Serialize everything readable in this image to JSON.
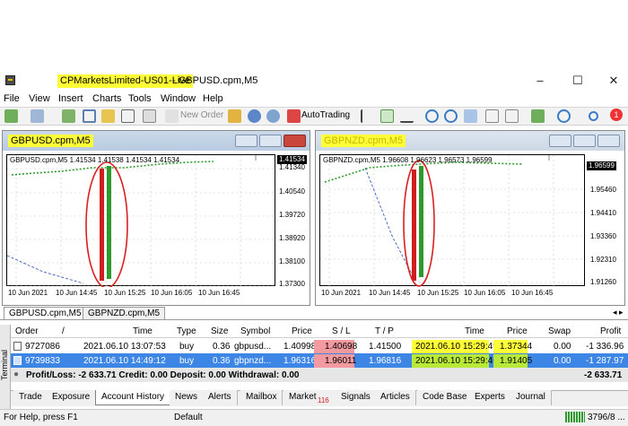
{
  "window": {
    "title_highlight": "CPMarketsLimited-US01-Live",
    "title_rest": "- GBPUSD.cpm,M5",
    "controls": [
      "–",
      "☐",
      "✕"
    ]
  },
  "menu": [
    "File",
    "View",
    "Insert",
    "Charts",
    "Tools",
    "Window",
    "Help"
  ],
  "toolbar": {
    "new_order": "New Order",
    "autotrading": "AutoTrading",
    "notification_count": "1"
  },
  "charts": [
    {
      "title": "GBPUSD.cpm,M5",
      "info": "GBPUSD.cpm,M5  1.41534 1.41538 1.41534 1.41534",
      "current_price": "1.41534",
      "yticks": [
        "1.41340",
        "1.40540",
        "1.39720",
        "1.38920",
        "1.38100",
        "1.37300"
      ],
      "xticks": [
        "10 Jun 2021",
        "10 Jun 14:45",
        "10 Jun 15:25",
        "10 Jun 16:05",
        "10 Jun 16:45"
      ]
    },
    {
      "title": "GBPNZD.cpm,M5",
      "info": "GBPNZD.cpm,M5  1.96608 1.96623 1.96573 1.96599",
      "current_price": "1.96599",
      "yticks": [
        "1.95460",
        "1.94410",
        "1.93360",
        "1.92310",
        "1.91260"
      ],
      "xticks": [
        "10 Jun 2021",
        "10 Jun 14:45",
        "10 Jun 15:25",
        "10 Jun 16:05",
        "10 Jun 16:45"
      ]
    }
  ],
  "chart_tabs": [
    "GBPUSD.cpm,M5",
    "GBPNZD.cpm,M5"
  ],
  "terminal": {
    "headers": [
      "Order",
      "/",
      "Time",
      "Type",
      "Size",
      "Symbol",
      "Price",
      "S / L",
      "T / P",
      "Time",
      "Price",
      "Swap",
      "Profit"
    ],
    "rows": [
      {
        "order": "9727086",
        "time": "2021.06.10 13:07:53",
        "type": "buy",
        "size": "0.36",
        "symbol": "gbpusd...",
        "price": "1.40998",
        "sl": "1.40698",
        "tp": "1.41500",
        "time2": "2021.06.10 15:29:49",
        "price2": "1.37344",
        "swap": "0.00",
        "profit": "-1 336.96"
      },
      {
        "order": "9739833",
        "time": "2021.06.10 14:49:12",
        "type": "buy",
        "size": "0.36",
        "symbol": "gbpnzd...",
        "price": "1.96316",
        "sl": "1.96011",
        "tp": "1.96816",
        "time2": "2021.06.10 15:29:46",
        "price2": "1.91405",
        "swap": "0.00",
        "profit": "-1 287.97"
      }
    ],
    "summary": "Profit/Loss: -2 633.71  Credit: 0.00  Deposit: 0.00  Withdrawal: 0.00",
    "summary_total": "-2 633.71",
    "side_label": "Terminal",
    "tabs": [
      "Trade",
      "Exposure",
      "Account History",
      "News",
      "Alerts",
      "Mailbox",
      "Market",
      "Signals",
      "Articles",
      "Code Base",
      "Experts",
      "Journal"
    ],
    "market_badge": "116"
  },
  "status": {
    "help": "For Help, press F1",
    "profile": "Default",
    "traffic": "3796/8 ..."
  },
  "colors": {
    "highlight": "#ffff38",
    "selected_row": "#3d86e6",
    "sl_cell": "#f29aa0",
    "annotation": "#d92020",
    "bull": "#2e9a2e",
    "bear": "#d01e1e"
  }
}
